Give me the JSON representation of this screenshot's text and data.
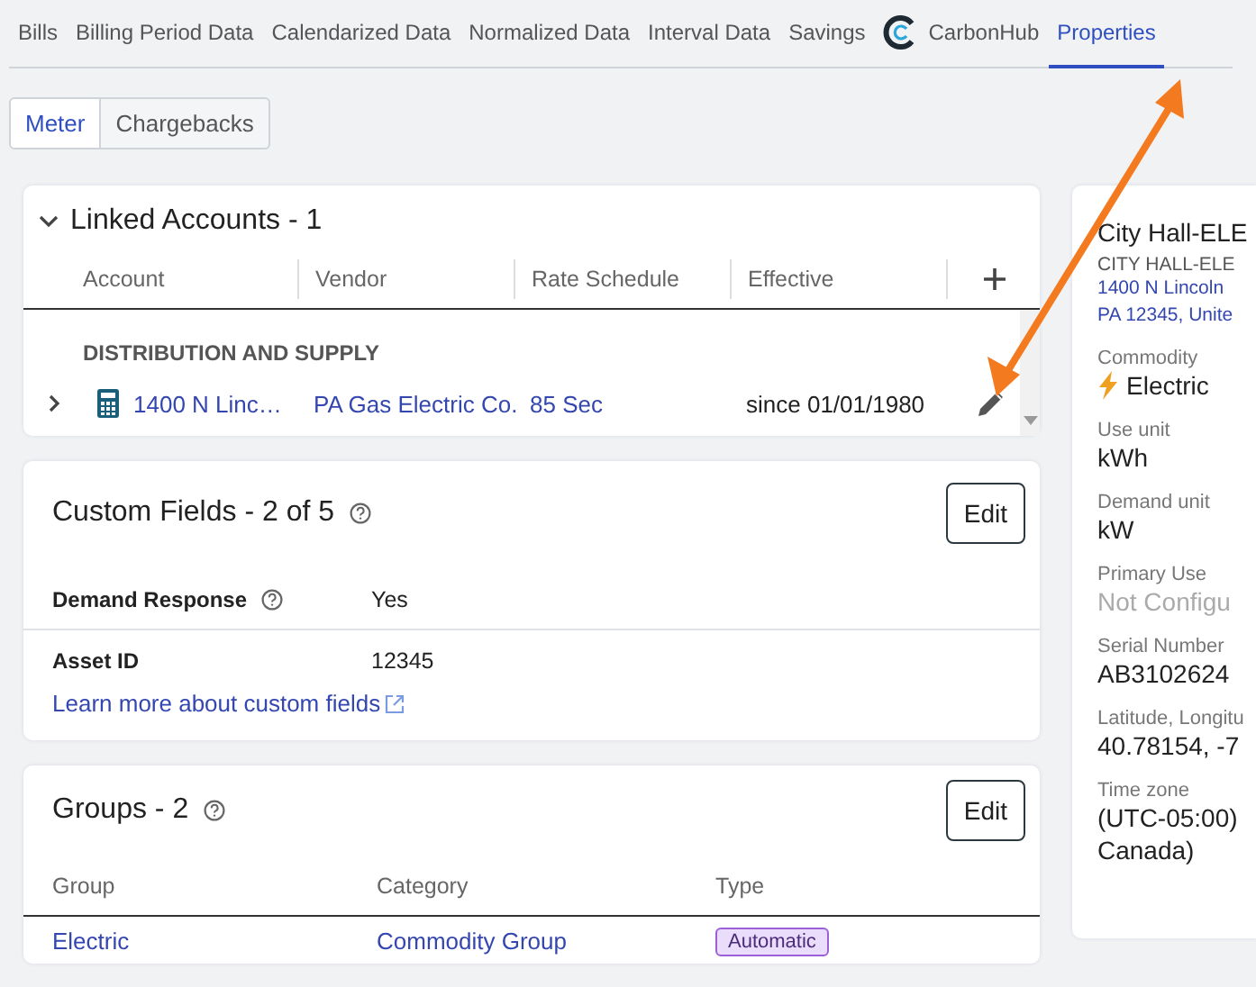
{
  "nav_tabs": [
    {
      "label": "Bills",
      "selected": false,
      "kind": "text"
    },
    {
      "label": "Billing Period Data",
      "selected": false,
      "kind": "text"
    },
    {
      "label": "Calendarized Data",
      "selected": false,
      "kind": "text"
    },
    {
      "label": "Normalized Data",
      "selected": false,
      "kind": "text"
    },
    {
      "label": "Interval Data",
      "selected": false,
      "kind": "text"
    },
    {
      "label": "Savings",
      "selected": false,
      "kind": "text"
    },
    {
      "label": "CarbonHub",
      "selected": false,
      "kind": "logo"
    },
    {
      "label": "Properties",
      "selected": true,
      "kind": "text"
    }
  ],
  "sub_tabs": [
    {
      "label": "Meter",
      "selected": true
    },
    {
      "label": "Chargebacks",
      "selected": false
    }
  ],
  "linked_accounts": {
    "title": "Linked Accounts - 1",
    "expanded": true,
    "columns": [
      "Account",
      "Vendor",
      "Rate Schedule",
      "Effective"
    ],
    "section": "DISTRIBUTION AND SUPPLY",
    "rows": [
      {
        "account": "1400 N Linc…",
        "vendor": "PA Gas Electric Co.",
        "rate_schedule": "85 Sec",
        "effective": "since 01/01/1980",
        "expanded": false
      }
    ]
  },
  "custom_fields": {
    "title": "Custom Fields - 2 of 5",
    "edit_button": "Edit",
    "fields": [
      {
        "label": "Demand Response",
        "value": "Yes",
        "help": true
      },
      {
        "label": "Asset ID",
        "value": "12345",
        "help": false
      }
    ],
    "link": "Learn more about custom fields"
  },
  "groups": {
    "title": "Groups - 2",
    "edit_button": "Edit",
    "columns": [
      "Group",
      "Category",
      "Type"
    ],
    "rows": [
      {
        "group": "Electric",
        "category": "Commodity Group",
        "type": "Automatic"
      }
    ]
  },
  "meter_panel": {
    "name": "City Hall-ELE",
    "code": "CITY HALL-ELE",
    "address": [
      "1400 N Lincoln",
      "PA 12345, Unite"
    ],
    "properties": [
      {
        "label": "Commodity",
        "lines": [
          "Electric"
        ],
        "kind": "commodity"
      },
      {
        "label": "Use unit",
        "lines": [
          "kWh"
        ],
        "kind": "plain"
      },
      {
        "label": "Demand unit",
        "lines": [
          "kW"
        ],
        "kind": "plain"
      },
      {
        "label": "Primary Use",
        "lines": [
          "Not Configu"
        ],
        "kind": "unset"
      },
      {
        "label": "Serial Number",
        "lines": [
          "AB3102624"
        ],
        "kind": "plain"
      },
      {
        "label": "Latitude, Longitu",
        "lines": [
          "40.78154, -7"
        ],
        "kind": "plain"
      },
      {
        "label": "Time zone",
        "lines": [
          "(UTC-05:00)",
          "Canada)"
        ],
        "kind": "plain"
      }
    ]
  }
}
